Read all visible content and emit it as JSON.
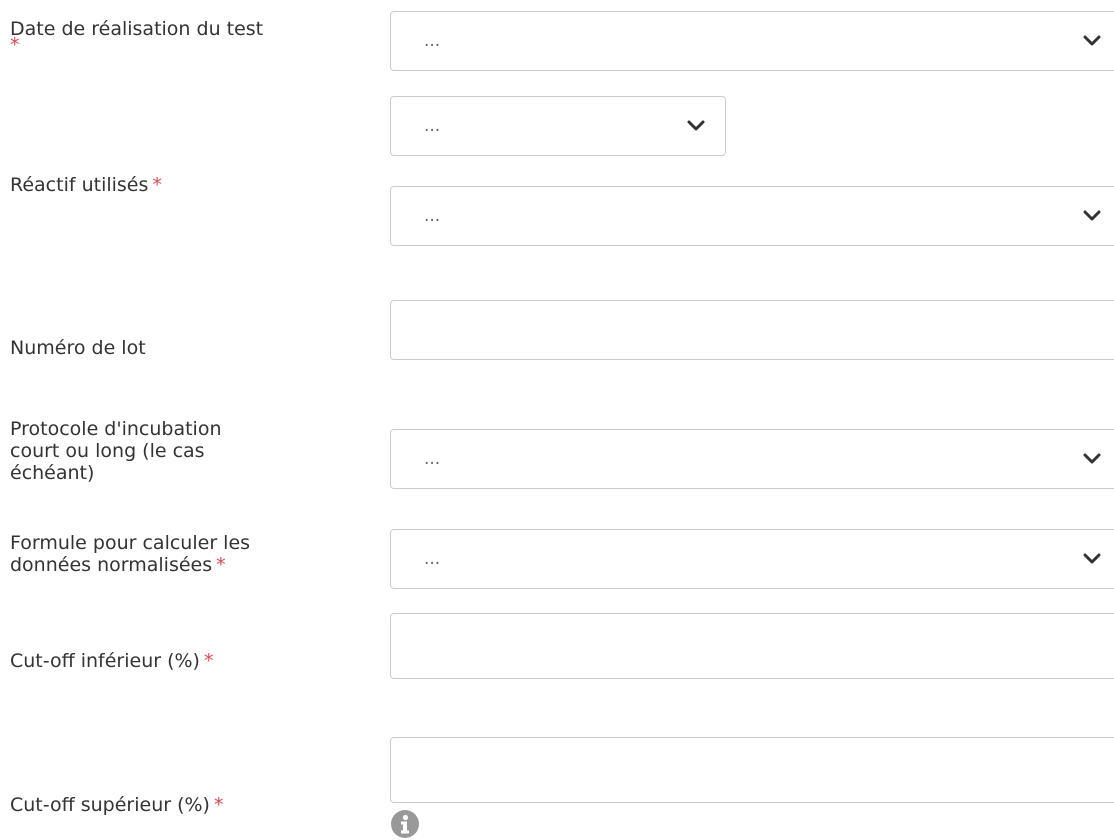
{
  "fields": [
    {
      "label": "Date de réalisation du test",
      "required_mark": "*",
      "type": "select",
      "value": "..."
    },
    {
      "label": "",
      "type": "select",
      "value": "..."
    },
    {
      "label": "Réactif utilisés",
      "required_mark": "*",
      "type": "select",
      "value": "..."
    },
    {
      "label": "Numéro de lot",
      "type": "text",
      "value": ""
    },
    {
      "label_lines": [
        "Protocole d'incubation",
        "court ou long (le cas",
        "échéant)"
      ],
      "type": "select",
      "value": "..."
    },
    {
      "label_lines": [
        "Formule pour calculer les",
        "données normalisées"
      ],
      "required_mark": "*",
      "type": "select",
      "value": "..."
    },
    {
      "label": "Cut-off inférieur (%)",
      "required_mark": "*",
      "type": "text",
      "value": ""
    },
    {
      "label": "Cut-off supérieur (%)",
      "required_mark": "*",
      "type": "text",
      "value": ""
    }
  ],
  "icons": {
    "select_arrow": "chevron-down-icon",
    "help": "info-icon"
  },
  "colors": {
    "required": "#e0474c",
    "border": "#cccccc",
    "label_text": "#333333",
    "value_text": "#666666",
    "info_icon": "#999999"
  }
}
